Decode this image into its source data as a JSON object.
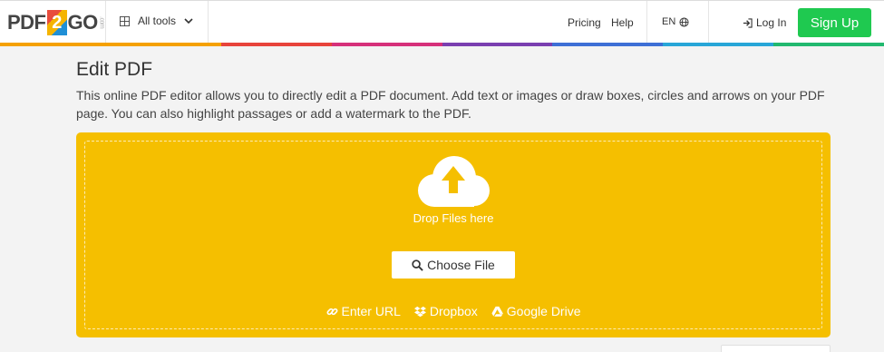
{
  "header": {
    "logo": {
      "prefix": "PDF",
      "mid": "2",
      "suffix": "GO",
      "tld": ".com"
    },
    "all_tools_label": "All tools",
    "nav": {
      "pricing": "Pricing",
      "help": "Help"
    },
    "language": "EN",
    "login_label": "Log In",
    "signup_label": "Sign Up"
  },
  "colors": {
    "accent_yellow": "#f5bf00",
    "signup_green": "#1fc950",
    "rainbow": [
      "#f5a100",
      "#f5a100",
      "#e8433b",
      "#d6307a",
      "#7a3fb0",
      "#3d6fd6",
      "#27a6d8",
      "#22b96f"
    ]
  },
  "main": {
    "title": "Edit PDF",
    "description": "This online PDF editor allows you to directly edit a PDF document. Add text or images or draw boxes, circles and arrows on your PDF page. You can also highlight passages or add a watermark to the PDF.",
    "dropzone": {
      "drop_text": "Drop Files here",
      "choose_label": "Choose File",
      "sources": [
        {
          "icon": "link-icon",
          "label": "Enter URL"
        },
        {
          "icon": "dropbox-icon",
          "label": "Dropbox"
        },
        {
          "icon": "google-drive-icon",
          "label": "Google Drive"
        }
      ]
    }
  }
}
